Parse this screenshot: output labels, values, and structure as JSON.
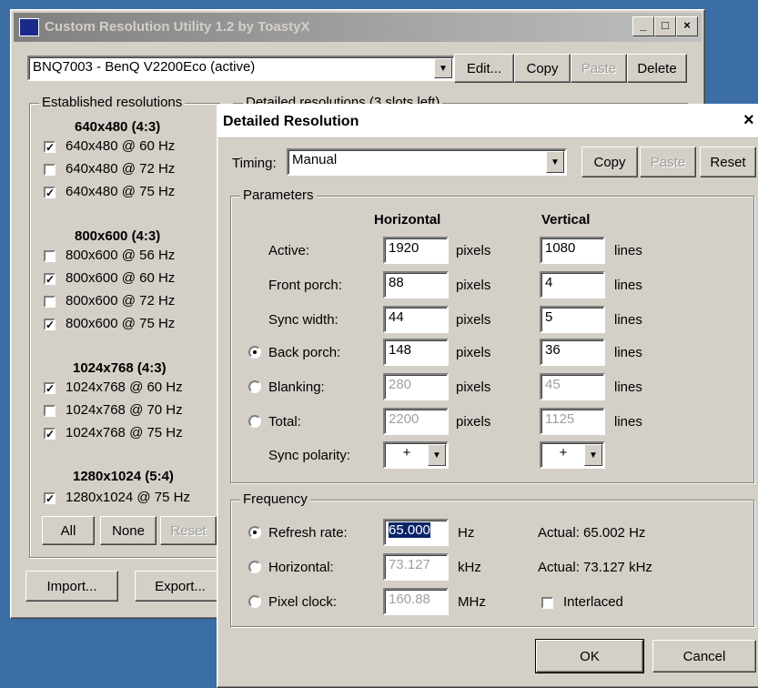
{
  "main_window": {
    "title": "Custom Resolution Utility 1.2 by ToastyX",
    "monitor_select": "BNQ7003 - BenQ V2200Eco (active)",
    "buttons": {
      "edit": "Edit...",
      "copy": "Copy",
      "paste": "Paste",
      "delete": "Delete"
    },
    "established_label": "Established resolutions",
    "detailed_label": "Detailed resolutions (3 slots left)",
    "groups": [
      {
        "header": "640x480 (4:3)",
        "items": [
          {
            "label": "640x480 @ 60 Hz",
            "checked": true
          },
          {
            "label": "640x480 @ 72 Hz",
            "checked": false
          },
          {
            "label": "640x480 @ 75 Hz",
            "checked": true
          }
        ]
      },
      {
        "header": "800x600 (4:3)",
        "items": [
          {
            "label": "800x600 @ 56 Hz",
            "checked": false
          },
          {
            "label": "800x600 @ 60 Hz",
            "checked": true
          },
          {
            "label": "800x600 @ 72 Hz",
            "checked": false
          },
          {
            "label": "800x600 @ 75 Hz",
            "checked": true
          }
        ]
      },
      {
        "header": "1024x768 (4:3)",
        "items": [
          {
            "label": "1024x768 @ 60 Hz",
            "checked": true
          },
          {
            "label": "1024x768 @ 70 Hz",
            "checked": false
          },
          {
            "label": "1024x768 @ 75 Hz",
            "checked": true
          }
        ]
      },
      {
        "header": "1280x1024 (5:4)",
        "items": [
          {
            "label": "1280x1024 @ 75 Hz",
            "checked": true
          }
        ]
      }
    ],
    "all_button": "All",
    "none_button": "None",
    "reset_button": "Reset",
    "import_button": "Import...",
    "export_button": "Export..."
  },
  "dialog": {
    "title": "Detailed Resolution",
    "close_glyph": "×",
    "timing_label": "Timing:",
    "timing_value": "Manual",
    "copy_button": "Copy",
    "paste_button": "Paste",
    "reset_button": "Reset",
    "parameters_label": "Parameters",
    "horizontal_header": "Horizontal",
    "vertical_header": "Vertical",
    "rows": [
      {
        "label": "Active:",
        "h": "1920",
        "h_unit": "pixels",
        "v": "1080",
        "v_unit": "lines",
        "radio": null,
        "disabled": false
      },
      {
        "label": "Front porch:",
        "h": "88",
        "h_unit": "pixels",
        "v": "4",
        "v_unit": "lines",
        "radio": null,
        "disabled": false
      },
      {
        "label": "Sync width:",
        "h": "44",
        "h_unit": "pixels",
        "v": "5",
        "v_unit": "lines",
        "radio": null,
        "disabled": false
      },
      {
        "label": "Back porch:",
        "h": "148",
        "h_unit": "pixels",
        "v": "36",
        "v_unit": "lines",
        "radio": true,
        "disabled": false
      },
      {
        "label": "Blanking:",
        "h": "280",
        "h_unit": "pixels",
        "v": "45",
        "v_unit": "lines",
        "radio": false,
        "disabled": true
      },
      {
        "label": "Total:",
        "h": "2200",
        "h_unit": "pixels",
        "v": "1125",
        "v_unit": "lines",
        "radio": false,
        "disabled": true
      }
    ],
    "sync_polarity_label": "Sync polarity:",
    "sync_h": "+",
    "sync_v": "+",
    "frequency_label": "Frequency",
    "refresh_label": "Refresh rate:",
    "refresh_value": "65.000",
    "refresh_unit": "Hz",
    "refresh_actual": "Actual: 65.002 Hz",
    "horizontal_label": "Horizontal:",
    "horizontal_value": "73.127",
    "horizontal_unit": "kHz",
    "horizontal_actual": "Actual: 73.127 kHz",
    "pixel_label": "Pixel clock:",
    "pixel_value": "160.88",
    "pixel_unit": "MHz",
    "interlaced_label": "Interlaced",
    "ok_button": "OK",
    "cancel_button": "Cancel"
  },
  "colors": {
    "desktop": "#3a6ea5",
    "face": "#d4d0c8",
    "title_active": "#0a246a",
    "title_inactive": "#808080"
  }
}
